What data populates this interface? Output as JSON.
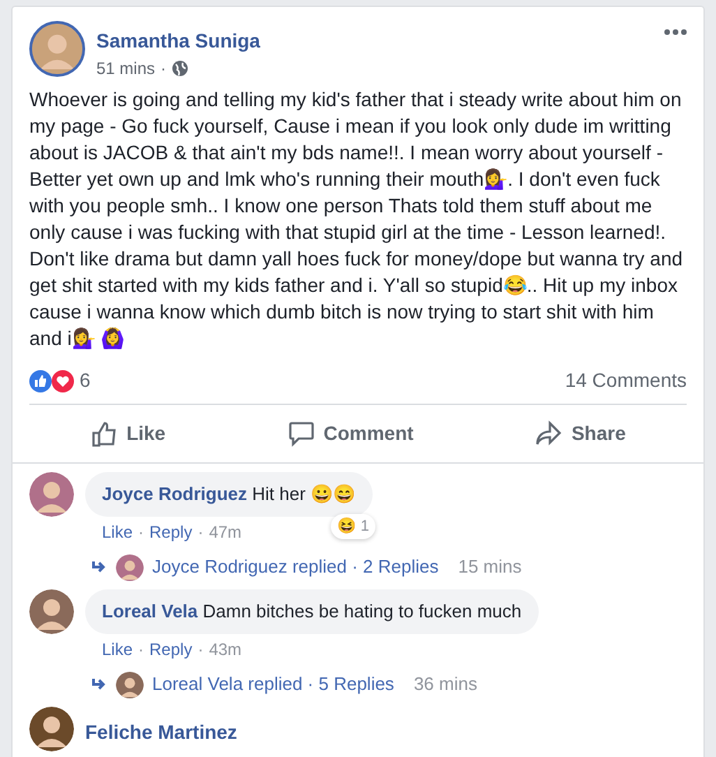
{
  "post": {
    "author": "Samantha Suniga",
    "time": "51 mins",
    "separator": "·",
    "text": "Whoever is going and telling my kid's father that i steady write about him on my page - Go fuck yourself, Cause i mean if you look only dude im writting about is JACOB & that ain't my bds name!!. I mean worry about yourself - Better yet own up and lmk who's running their mouth💁‍♀️. I don't even fuck with you people smh.. I know one person Thats told them stuff about me only cause i was fucking with that stupid girl at the time - Lesson learned!. Don't like drama but damn yall hoes fuck for money/dope but wanna try and get shit started with my kids father and i. Y'all so stupid😂.. Hit up my inbox cause i wanna know which dumb bitch is now trying to start shit with him and i💁‍♀️ 🙆‍♀️",
    "reaction_count": "6",
    "comments_count": "14 Comments",
    "actions": [
      {
        "kind": "like",
        "label": "Like"
      },
      {
        "kind": "comment",
        "label": "Comment"
      },
      {
        "kind": "share",
        "label": "Share"
      }
    ]
  },
  "comments": [
    {
      "author": "Joyce Rodriguez",
      "text": "Hit her 😀😄",
      "separator": "·",
      "reaction": {
        "emoji": "😆",
        "count": "1"
      },
      "links": [
        "Like",
        "Reply",
        "47m"
      ],
      "replies": {
        "who": "Joyce Rodriguez replied",
        "count": "2 Replies",
        "time": "15 mins"
      }
    },
    {
      "author": "Loreal Vela",
      "text": "Damn bitches be hating to fucken much",
      "separator": "·",
      "links": [
        "Like",
        "Reply",
        "43m"
      ],
      "replies": {
        "who": "Loreal Vela replied",
        "count": "5 Replies",
        "time": "36 mins"
      }
    },
    {
      "author": "Feliche Martinez"
    }
  ]
}
